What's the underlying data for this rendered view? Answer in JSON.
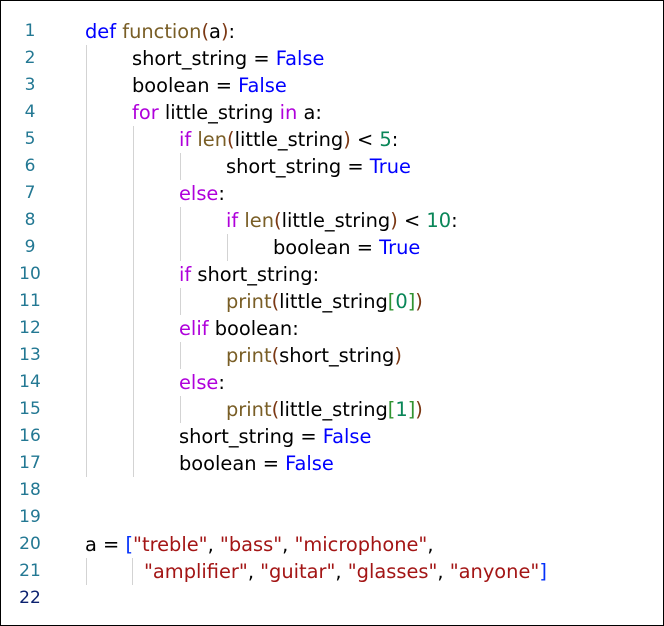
{
  "editor": {
    "current_line": 22,
    "lines": [
      {
        "n": "1",
        "indent": 0,
        "tokens": [
          {
            "t": "def",
            "c": "kw"
          },
          {
            "t": " ",
            "c": "plain"
          },
          {
            "t": "function",
            "c": "fn"
          },
          {
            "t": "(",
            "c": "br2"
          },
          {
            "t": "a",
            "c": "plain"
          },
          {
            "t": ")",
            "c": "br2"
          },
          {
            "t": ":",
            "c": "op"
          }
        ]
      },
      {
        "n": "2",
        "indent": 1,
        "tokens": [
          {
            "t": "short_string",
            "c": "plain"
          },
          {
            "t": " = ",
            "c": "op"
          },
          {
            "t": "False",
            "c": "const"
          }
        ]
      },
      {
        "n": "3",
        "indent": 1,
        "tokens": [
          {
            "t": "boolean",
            "c": "plain"
          },
          {
            "t": " = ",
            "c": "op"
          },
          {
            "t": "False",
            "c": "const"
          }
        ]
      },
      {
        "n": "4",
        "indent": 1,
        "tokens": [
          {
            "t": "for",
            "c": "ctrl"
          },
          {
            "t": " little_string ",
            "c": "plain"
          },
          {
            "t": "in",
            "c": "ctrl"
          },
          {
            "t": " a",
            "c": "plain"
          },
          {
            "t": ":",
            "c": "op"
          }
        ]
      },
      {
        "n": "5",
        "indent": 2,
        "tokens": [
          {
            "t": "if",
            "c": "ctrl"
          },
          {
            "t": " ",
            "c": "plain"
          },
          {
            "t": "len",
            "c": "fn"
          },
          {
            "t": "(",
            "c": "br2"
          },
          {
            "t": "little_string",
            "c": "plain"
          },
          {
            "t": ")",
            "c": "br2"
          },
          {
            "t": " < ",
            "c": "op"
          },
          {
            "t": "5",
            "c": "num"
          },
          {
            "t": ":",
            "c": "op"
          }
        ]
      },
      {
        "n": "6",
        "indent": 3,
        "tokens": [
          {
            "t": "short_string",
            "c": "plain"
          },
          {
            "t": " = ",
            "c": "op"
          },
          {
            "t": "True",
            "c": "const"
          }
        ]
      },
      {
        "n": "7",
        "indent": 2,
        "tokens": [
          {
            "t": "else",
            "c": "ctrl"
          },
          {
            "t": ":",
            "c": "op"
          }
        ]
      },
      {
        "n": "8",
        "indent": 3,
        "tokens": [
          {
            "t": "if",
            "c": "ctrl"
          },
          {
            "t": " ",
            "c": "plain"
          },
          {
            "t": "len",
            "c": "fn"
          },
          {
            "t": "(",
            "c": "br2"
          },
          {
            "t": "little_string",
            "c": "plain"
          },
          {
            "t": ")",
            "c": "br2"
          },
          {
            "t": " < ",
            "c": "op"
          },
          {
            "t": "10",
            "c": "num"
          },
          {
            "t": ":",
            "c": "op"
          }
        ]
      },
      {
        "n": "9",
        "indent": 4,
        "tokens": [
          {
            "t": "boolean",
            "c": "plain"
          },
          {
            "t": " = ",
            "c": "op"
          },
          {
            "t": "True",
            "c": "const"
          }
        ]
      },
      {
        "n": "10",
        "indent": 2,
        "tokens": [
          {
            "t": "if",
            "c": "ctrl"
          },
          {
            "t": " short_string",
            "c": "plain"
          },
          {
            "t": ":",
            "c": "op"
          }
        ]
      },
      {
        "n": "11",
        "indent": 3,
        "tokens": [
          {
            "t": "print",
            "c": "fn"
          },
          {
            "t": "(",
            "c": "br2"
          },
          {
            "t": "little_string",
            "c": "plain"
          },
          {
            "t": "[",
            "c": "br1"
          },
          {
            "t": "0",
            "c": "num"
          },
          {
            "t": "]",
            "c": "br1"
          },
          {
            "t": ")",
            "c": "br2"
          }
        ]
      },
      {
        "n": "12",
        "indent": 2,
        "tokens": [
          {
            "t": "elif",
            "c": "ctrl"
          },
          {
            "t": " boolean",
            "c": "plain"
          },
          {
            "t": ":",
            "c": "op"
          }
        ]
      },
      {
        "n": "13",
        "indent": 3,
        "tokens": [
          {
            "t": "print",
            "c": "fn"
          },
          {
            "t": "(",
            "c": "br2"
          },
          {
            "t": "short_string",
            "c": "plain"
          },
          {
            "t": ")",
            "c": "br2"
          }
        ]
      },
      {
        "n": "14",
        "indent": 2,
        "tokens": [
          {
            "t": "else",
            "c": "ctrl"
          },
          {
            "t": ":",
            "c": "op"
          }
        ]
      },
      {
        "n": "15",
        "indent": 3,
        "tokens": [
          {
            "t": "print",
            "c": "fn"
          },
          {
            "t": "(",
            "c": "br2"
          },
          {
            "t": "little_string",
            "c": "plain"
          },
          {
            "t": "[",
            "c": "br1"
          },
          {
            "t": "1",
            "c": "num"
          },
          {
            "t": "]",
            "c": "br1"
          },
          {
            "t": ")",
            "c": "br2"
          }
        ]
      },
      {
        "n": "16",
        "indent": 2,
        "tokens": [
          {
            "t": "short_string",
            "c": "plain"
          },
          {
            "t": " = ",
            "c": "op"
          },
          {
            "t": "False",
            "c": "const"
          }
        ]
      },
      {
        "n": "17",
        "indent": 2,
        "tokens": [
          {
            "t": "boolean",
            "c": "plain"
          },
          {
            "t": " = ",
            "c": "op"
          },
          {
            "t": "False",
            "c": "const"
          }
        ]
      },
      {
        "n": "18",
        "indent": 0,
        "tokens": []
      },
      {
        "n": "19",
        "indent": 0,
        "tokens": []
      },
      {
        "n": "20",
        "indent": 0,
        "tokens": [
          {
            "t": "a",
            "c": "plain"
          },
          {
            "t": " = ",
            "c": "op"
          },
          {
            "t": "[",
            "c": "br0"
          },
          {
            "t": "\"treble\"",
            "c": "str"
          },
          {
            "t": ", ",
            "c": "op"
          },
          {
            "t": "\"bass\"",
            "c": "str"
          },
          {
            "t": ", ",
            "c": "op"
          },
          {
            "t": "\"microphone\"",
            "c": "str"
          },
          {
            "t": ",",
            "c": "op"
          }
        ]
      },
      {
        "n": "21",
        "indent": "cont",
        "tokens": [
          {
            "t": "\"amplifier\"",
            "c": "str"
          },
          {
            "t": ", ",
            "c": "op"
          },
          {
            "t": "\"guitar\"",
            "c": "str"
          },
          {
            "t": ", ",
            "c": "op"
          },
          {
            "t": "\"glasses\"",
            "c": "str"
          },
          {
            "t": ", ",
            "c": "op"
          },
          {
            "t": "\"anyone\"",
            "c": "str"
          },
          {
            "t": "]",
            "c": "br0"
          }
        ]
      },
      {
        "n": "22",
        "indent": 0,
        "tokens": []
      }
    ]
  }
}
